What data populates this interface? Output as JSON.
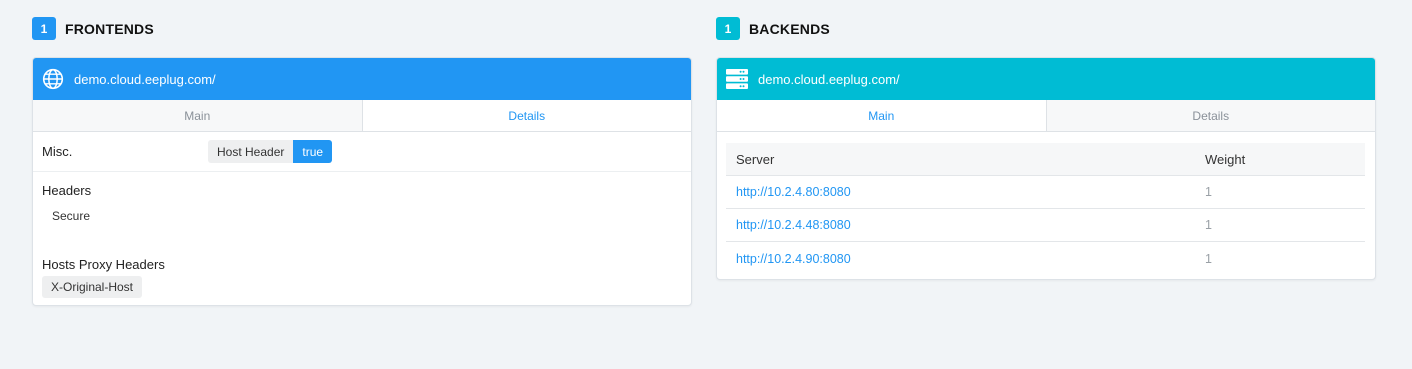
{
  "frontends": {
    "count": "1",
    "title": "FRONTENDS",
    "color": "#2196f3",
    "card": {
      "name": "demo.cloud.eeplug.com/",
      "icon": "globe-icon",
      "tabs": [
        {
          "label": "Main",
          "active": false
        },
        {
          "label": "Details",
          "active": true
        }
      ],
      "misc": {
        "label": "Misc.",
        "key": "Host Header",
        "value": "true"
      },
      "headers": {
        "label": "Headers",
        "items": [
          "Secure"
        ]
      },
      "proxy_headers": {
        "label": "Hosts Proxy Headers",
        "items": [
          "X-Original-Host"
        ]
      }
    }
  },
  "backends": {
    "count": "1",
    "title": "BACKENDS",
    "color": "#00bcd4",
    "card": {
      "name": "demo.cloud.eeplug.com/",
      "icon": "server-icon",
      "tabs": [
        {
          "label": "Main",
          "active": true
        },
        {
          "label": "Details",
          "active": false
        }
      ],
      "table": {
        "columns": [
          "Server",
          "Weight"
        ],
        "rows": [
          {
            "server": "http://10.2.4.80:8080",
            "weight": "1"
          },
          {
            "server": "http://10.2.4.48:8080",
            "weight": "1"
          },
          {
            "server": "http://10.2.4.90:8080",
            "weight": "1"
          }
        ]
      }
    }
  }
}
